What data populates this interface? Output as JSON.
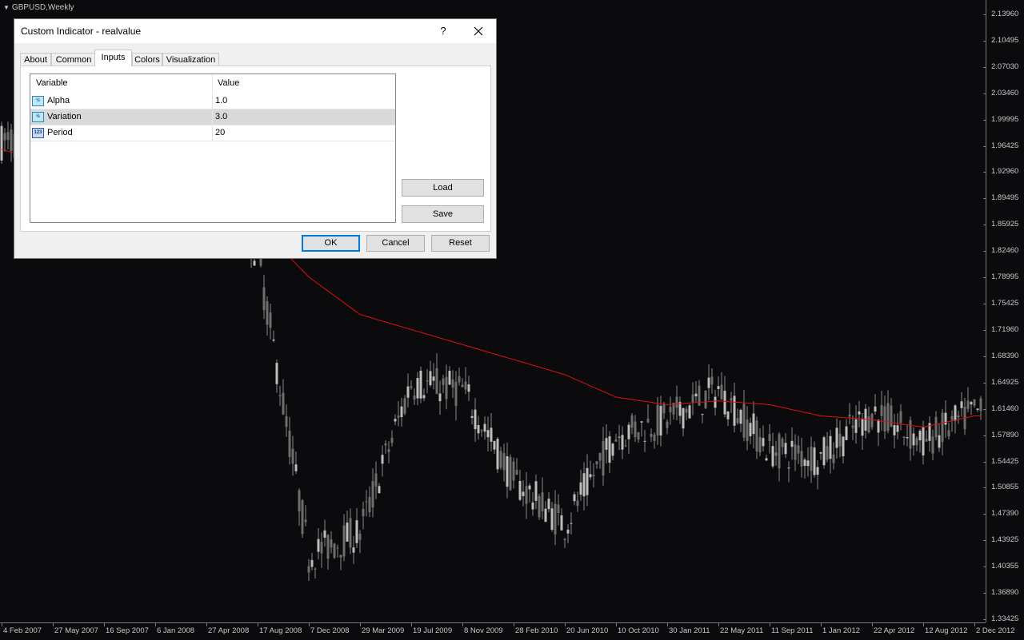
{
  "chart": {
    "symbol_timeframe": "GBPUSD,Weekly",
    "price_labels": [
      "2.13960",
      "2.10495",
      "2.07030",
      "2.03460",
      "1.99995",
      "1.96425",
      "1.92960",
      "1.89495",
      "1.85925",
      "1.82460",
      "1.78995",
      "1.75425",
      "1.71960",
      "1.68390",
      "1.64925",
      "1.61460",
      "1.57890",
      "1.54425",
      "1.50855",
      "1.47390",
      "1.43925",
      "1.40355",
      "1.36890",
      "1.33425"
    ],
    "time_labels": [
      "4 Feb 2007",
      "27 May 2007",
      "16 Sep 2007",
      "6 Jan 2008",
      "27 Apr 2008",
      "17 Aug 2008",
      "7 Dec 2008",
      "29 Mar 2009",
      "19 Jul 2009",
      "8 Nov 2009",
      "28 Feb 2010",
      "20 Jun 2010",
      "10 Oct 2010",
      "30 Jan 2011",
      "22 May 2011",
      "11 Sep 2011",
      "1 Jan 2012",
      "22 Apr 2012",
      "12 Aug 2012",
      "2 Dec 2012"
    ],
    "colors": {
      "background": "#0b0b0e",
      "candle": "#a9a9a9",
      "indicator_line": "#e01010",
      "axis_text": "#c8c8c8"
    }
  },
  "chart_data": {
    "type": "candlestick",
    "symbol": "GBPUSD",
    "timeframe": "Weekly",
    "ylim": [
      1.33425,
      2.1396
    ],
    "x_range": [
      "4 Feb 2007",
      "2 Dec 2012"
    ],
    "series": [
      {
        "name": "",
        "values": [
          {
            "x": "4 Feb 2007",
            "y": 1.96
          },
          {
            "x": "17 Aug 2008",
            "y": 1.86
          },
          {
            "x": "7 Dec 2008",
            "y": 1.79
          },
          {
            "x": "29 Mar 2009",
            "y": 1.74
          },
          {
            "x": "19 Jul 2009",
            "y": 1.72
          },
          {
            "x": "8 Nov 2009",
            "y": 1.7
          },
          {
            "x": "28 Feb 2010",
            "y": 1.68
          },
          {
            "x": "20 Jun 2010",
            "y": 1.66
          },
          {
            "x": "10 Oct 2010",
            "y": 1.63
          },
          {
            "x": "30 Jan 2011",
            "y": 1.62
          },
          {
            "x": "22 May 2011",
            "y": 1.625
          },
          {
            "x": "11 Sep 2011",
            "y": 1.62
          },
          {
            "x": "1 Jan 2012",
            "y": 1.605
          },
          {
            "x": "22 Apr 2012",
            "y": 1.6
          },
          {
            "x": "12 Aug 2012",
            "y": 1.59
          },
          {
            "x": "2 Dec 2012",
            "y": 1.605
          }
        ]
      }
    ],
    "price_path": [
      {
        "x": "4 Feb 2007",
        "y": 1.97
      },
      {
        "x": "27 Apr 2008",
        "y": 1.98
      },
      {
        "x": "17 Aug 2008",
        "y": 1.82
      },
      {
        "x": "7 Dec 2008",
        "y": 1.42
      },
      {
        "x": "29 Mar 2009",
        "y": 1.45
      },
      {
        "x": "19 Jul 2009",
        "y": 1.65
      },
      {
        "x": "8 Nov 2009",
        "y": 1.64
      },
      {
        "x": "28 Feb 2010",
        "y": 1.52
      },
      {
        "x": "20 Jun 2010",
        "y": 1.46
      },
      {
        "x": "10 Oct 2010",
        "y": 1.58
      },
      {
        "x": "30 Jan 2011",
        "y": 1.6
      },
      {
        "x": "22 May 2011",
        "y": 1.64
      },
      {
        "x": "11 Sep 2011",
        "y": 1.56
      },
      {
        "x": "1 Jan 2012",
        "y": 1.55
      },
      {
        "x": "22 Apr 2012",
        "y": 1.61
      },
      {
        "x": "12 Aug 2012",
        "y": 1.57
      },
      {
        "x": "2 Dec 2012",
        "y": 1.61
      }
    ]
  },
  "dialog": {
    "title": "Custom Indicator - realvalue",
    "help": "?",
    "tabs": [
      "About",
      "Common",
      "Inputs",
      "Colors",
      "Visualization"
    ],
    "active_tab": "Inputs",
    "columns": {
      "variable": "Variable",
      "value": "Value"
    },
    "params": [
      {
        "name": "Alpha",
        "value": "1.0",
        "type_icon": "double-type-icon",
        "icon_text": "½"
      },
      {
        "name": "Variation",
        "value": "3.0",
        "type_icon": "double-type-icon",
        "icon_text": "½"
      },
      {
        "name": "Period",
        "value": "20",
        "type_icon": "integer-type-icon",
        "icon_text": "123"
      }
    ],
    "selected_param": "Variation",
    "load_label": "Load",
    "save_label": "Save",
    "ok_label": "OK",
    "cancel_label": "Cancel",
    "reset_label": "Reset"
  }
}
